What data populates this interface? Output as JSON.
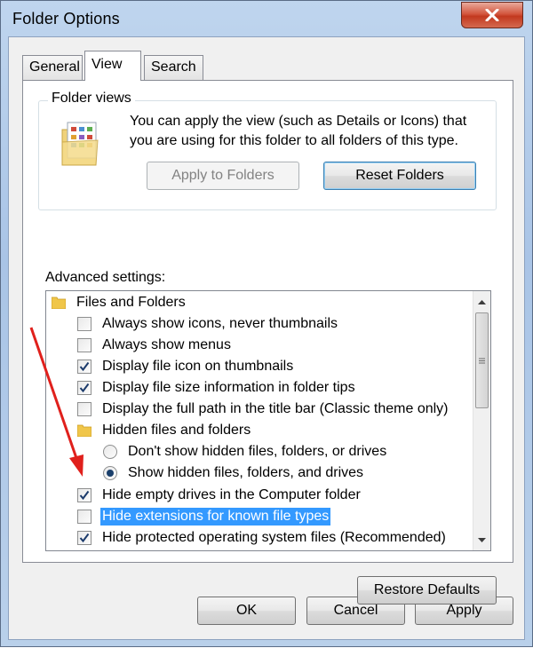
{
  "window": {
    "title": "Folder Options"
  },
  "tabs": [
    {
      "label": "General"
    },
    {
      "label": "View"
    },
    {
      "label": "Search"
    }
  ],
  "folder_views": {
    "group_title": "Folder views",
    "description": "You can apply the view (such as Details or Icons) that you are using for this folder to all folders of this type.",
    "apply_label": "Apply to Folders",
    "reset_label": "Reset Folders"
  },
  "advanced": {
    "label": "Advanced settings:",
    "items": [
      {
        "type": "folder",
        "label": "Files and Folders",
        "indent": 0
      },
      {
        "type": "checkbox",
        "label": "Always show icons, never thumbnails",
        "checked": false
      },
      {
        "type": "checkbox",
        "label": "Always show menus",
        "checked": false
      },
      {
        "type": "checkbox",
        "label": "Display file icon on thumbnails",
        "checked": true
      },
      {
        "type": "checkbox",
        "label": "Display file size information in folder tips",
        "checked": true
      },
      {
        "type": "checkbox",
        "label": "Display the full path in the title bar (Classic theme only)",
        "checked": false
      },
      {
        "type": "folder",
        "label": "Hidden files and folders",
        "indent": 1
      },
      {
        "type": "radio",
        "label": "Don't show hidden files, folders, or drives",
        "checked": false
      },
      {
        "type": "radio",
        "label": "Show hidden files, folders, and drives",
        "checked": true
      },
      {
        "type": "checkbox",
        "label": "Hide empty drives in the Computer folder",
        "checked": true
      },
      {
        "type": "checkbox",
        "label": "Hide extensions for known file types",
        "checked": false,
        "selected": true
      },
      {
        "type": "checkbox",
        "label": "Hide protected operating system files (Recommended)",
        "checked": true
      }
    ]
  },
  "buttons": {
    "restore_defaults": "Restore Defaults",
    "ok": "OK",
    "cancel": "Cancel",
    "apply": "Apply"
  },
  "icons": {
    "close": "close-icon",
    "folder": "folder-icon",
    "checkmark": "checkmark-icon",
    "scroll_up": "scroll-up-icon",
    "scroll_down": "scroll-down-icon"
  },
  "colors": {
    "selection": "#3399ff",
    "annotation_arrow": "#e0201c",
    "close_button": "#c7432b"
  }
}
